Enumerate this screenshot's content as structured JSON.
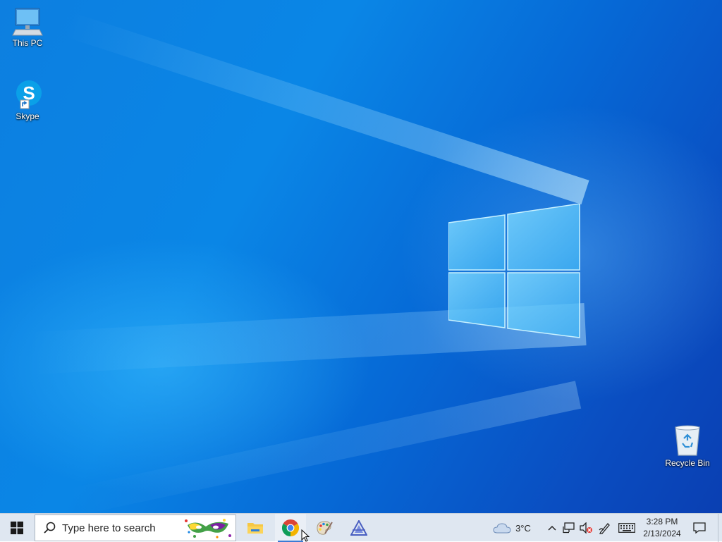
{
  "desktop": {
    "icons": [
      {
        "id": "this-pc",
        "label": "This PC"
      },
      {
        "id": "skype",
        "label": "Skype"
      },
      {
        "id": "recycle-bin",
        "label": "Recycle Bin"
      }
    ]
  },
  "taskbar": {
    "start_icon": "windows-logo-icon",
    "search": {
      "placeholder": "Type here to search",
      "icon": "search-icon"
    },
    "pinned": [
      {
        "name": "File Explorer",
        "icon": "folder-icon"
      },
      {
        "name": "Google Chrome",
        "icon": "chrome-icon",
        "active": true
      },
      {
        "name": "Paint",
        "icon": "paint-palette-icon"
      },
      {
        "name": "App",
        "icon": "triangle-app-icon"
      }
    ],
    "weather": {
      "temp": "3°C",
      "icon": "cloud-icon"
    },
    "tray_icons": [
      "chevron-up-icon",
      "network-icon",
      "volume-muted-icon",
      "pen-icon",
      "keyboard-icon"
    ],
    "clock": {
      "time": "3:28 PM",
      "date": "2/13/2024"
    },
    "notification_icon": "notification-icon"
  },
  "colors": {
    "taskbar_bg": "#dfe7f1",
    "desktop_accent": "#0a6fdb",
    "active_indicator": "#3a7bd5"
  }
}
